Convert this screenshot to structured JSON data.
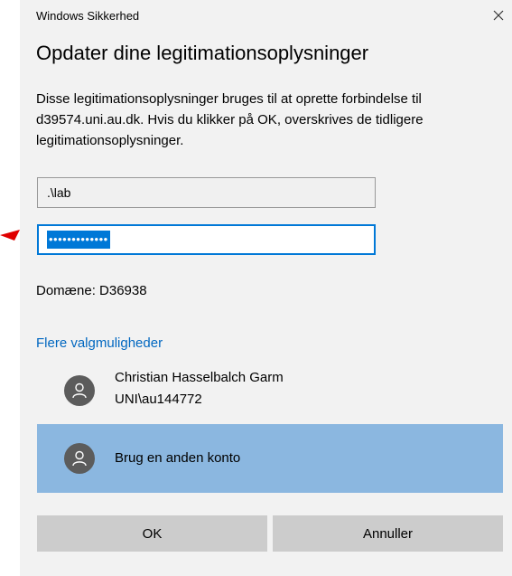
{
  "window": {
    "title": "Windows Sikkerhed",
    "close_icon": "close-icon"
  },
  "heading": "Opdater dine legitimationsoplysninger",
  "description": "Disse legitimationsoplysninger bruges til at oprette forbindelse til d39574.uni.au.dk. Hvis du klikker på OK, overskrives de tidligere legitimationsoplysninger.",
  "username": {
    "value": ".\\lab"
  },
  "password": {
    "masked_value": "•••••••••••••"
  },
  "domain_text": "Domæne: D36938",
  "more_options_link": "Flere valgmuligheder",
  "accounts": [
    {
      "name": "Christian Hasselbalch Garm",
      "user": "UNI\\au144772",
      "icon": "user-avatar-icon",
      "selected": false
    },
    {
      "name": "Brug en anden konto",
      "icon": "user-avatar-icon",
      "selected": true
    }
  ],
  "buttons": {
    "ok": "OK",
    "cancel": "Annuller"
  },
  "colors": {
    "accent": "#0078d7",
    "selected_account_bg": "#8bb7e0",
    "link": "#0067c0",
    "annotation_arrow": "#e00000"
  }
}
